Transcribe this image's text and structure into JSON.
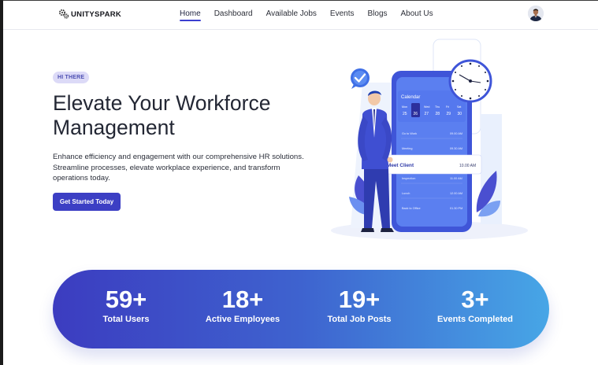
{
  "brand": {
    "name": "UNITYSPARK",
    "logo_icon": "gears-icon"
  },
  "nav": {
    "items": [
      {
        "label": "Home",
        "active": true
      },
      {
        "label": "Dashboard",
        "active": false
      },
      {
        "label": "Available Jobs",
        "active": false
      },
      {
        "label": "Events",
        "active": false
      },
      {
        "label": "Blogs",
        "active": false
      },
      {
        "label": "About Us",
        "active": false
      }
    ],
    "avatar_icon": "user-avatar"
  },
  "hero": {
    "badge": "HI THERE",
    "title": "Elevate Your Workforce Management",
    "description": "Enhance efficiency and engagement with our comprehensive HR solutions. Streamline processes, elevate workplace experience, and transform operations today.",
    "cta_label": "Get Started Today"
  },
  "illustration": {
    "calendar_title": "Calendar",
    "days": [
      "Mon",
      "Tue",
      "Wed",
      "Thu",
      "Fri",
      "Sat"
    ],
    "dates": [
      "25",
      "26",
      "27",
      "28",
      "29",
      "30"
    ],
    "selected_date": "26",
    "events": [
      {
        "name": "Go to Work",
        "time": "09.00 AM"
      },
      {
        "name": "Meeting",
        "time": "09.30 AM"
      },
      {
        "name": "Meet Client",
        "time": "10.00 AM"
      },
      {
        "name": "Inspection",
        "time": "11.00 AM"
      },
      {
        "name": "Lunch",
        "time": "12.00 AM"
      },
      {
        "name": "Back to Office",
        "time": "01.30 PM"
      }
    ]
  },
  "stats": [
    {
      "value": "59+",
      "label": "Total Users"
    },
    {
      "value": "18+",
      "label": "Active Employees"
    },
    {
      "value": "19+",
      "label": "Total Job Posts"
    },
    {
      "value": "3+",
      "label": "Events Completed"
    }
  ],
  "colors": {
    "primary": "#3c3fc4",
    "badge_bg": "#dcdaf7",
    "stats_gradient_start": "#3c3cc0",
    "stats_gradient_end": "#47a6e6"
  }
}
